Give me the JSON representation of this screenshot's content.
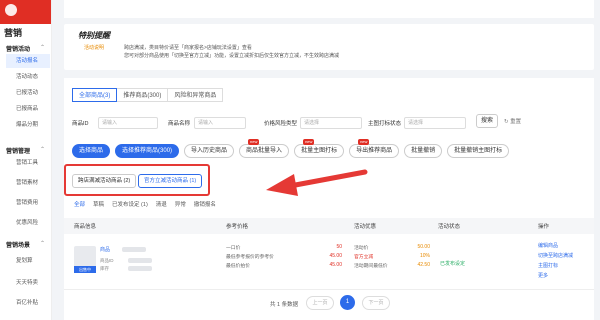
{
  "sidebar": {
    "title": "营销",
    "groups": [
      {
        "label": "营销活动",
        "items": [
          "活动报名",
          "活动动态",
          "已报活动",
          "已报商品",
          "爆品分期"
        ],
        "active": 0
      },
      {
        "label": "营销管理",
        "items": [
          "营销工具",
          "营销素材",
          "营销费用",
          "优惠风险"
        ]
      },
      {
        "label": "营销场景",
        "items": [
          "复划算",
          "天天特卖",
          "百亿补贴"
        ]
      }
    ]
  },
  "notice": {
    "title": "特别提醒",
    "tag": "活动说明",
    "line1": "跨店满减，类目特价请至「商家报名>店铺玩法设置」查看",
    "line2": "您可对部分商品使用「切换至官方立减」功能，设置立减折扣后仅生效官方立减，不生效跨店满减"
  },
  "tabs": [
    "全部商品(3)",
    "推荐商品(300)",
    "风险和异常商品"
  ],
  "filters": {
    "product_id": {
      "label": "商品ID",
      "placeholder": "请输入"
    },
    "product_name": {
      "label": "商品名称",
      "placeholder": "请输入"
    },
    "risk_type": {
      "label": "价格风险类型",
      "placeholder": "请选择"
    },
    "main_image_status": {
      "label": "主图打标状态",
      "placeholder": "请选择"
    },
    "search": "搜索",
    "reset": "重置"
  },
  "actions": {
    "select_products": "选择商品",
    "select_recommended": "选择推荐商品(300)",
    "import_history": "导入历史商品",
    "batch_import": "商品批量导入",
    "batch_main_image": "批量主图打标",
    "export_recommended": "导出推荐商品",
    "batch_withdraw": "批量撤销",
    "batch_withdraw_main": "批量撤销主图打标",
    "new_badge": "new"
  },
  "campaign": {
    "cross_store": "跨店满减活动商品 (2)",
    "official": "官方立减活动商品 (1)"
  },
  "status_tabs": [
    "全部",
    "草稿",
    "已发布设定 (1)",
    "清退",
    "异常",
    "撤销报名"
  ],
  "table": {
    "headers": [
      "商品信息",
      "参考价格",
      "活动优惠",
      "活动状态",
      "操作"
    ],
    "row": {
      "onsale": "出售中",
      "name": "商品",
      "meta": [
        "商品ID",
        "库存"
      ],
      "prices": [
        {
          "k": "一口价",
          "v": "50"
        },
        {
          "k": "最低参考报价的参考价",
          "v": "45.00"
        },
        {
          "k": "最低价拍价",
          "v": "45.00"
        }
      ],
      "promo": [
        {
          "k": "活动价",
          "v": "50.00"
        },
        {
          "k": "官方立减",
          "v": "10%"
        },
        {
          "k": "活动期间最低价",
          "v": "42.50"
        }
      ],
      "status": "已发布设定",
      "ops": [
        "编辑商品",
        "切换至跨店满减",
        "主图打标",
        "更多"
      ]
    }
  },
  "pager": {
    "total": "共 1 条数据",
    "prev": "上一页",
    "current": "1",
    "next": "下一页"
  },
  "colors": {
    "accent": "#2d6bea",
    "brand": "#e02e24",
    "highlight": "#e53935"
  }
}
